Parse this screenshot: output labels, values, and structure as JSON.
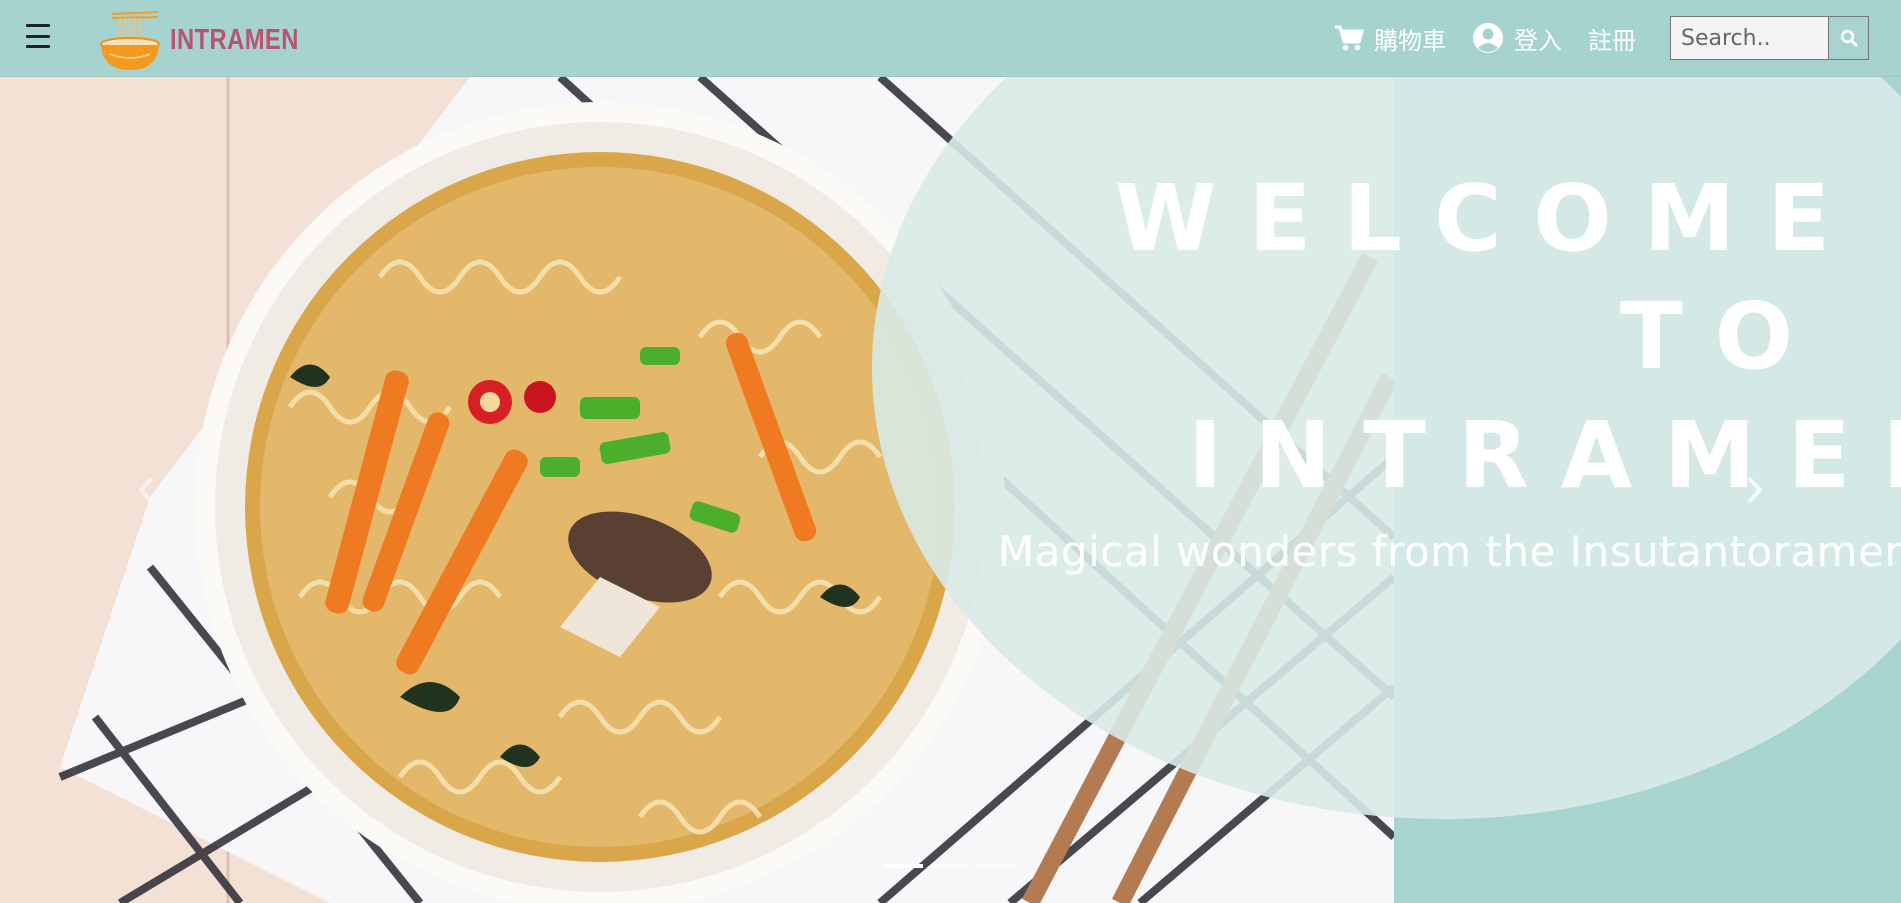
{
  "navbar": {
    "brand_name": "INTRAMEN",
    "cart_label": "購物車",
    "login_label": "登入",
    "register_label": "註冊",
    "search_placeholder": "Search.."
  },
  "hero": {
    "welcome_line1": "WELCOME",
    "welcome_line2": "TO",
    "welcome_line3": "INTRAMEN",
    "tagline": "Magical wonders from the Insutantoramen"
  },
  "carousel": {
    "slide_count": 3,
    "active_index": 0
  },
  "colors": {
    "nav_bg": "#a6d3cf",
    "brand": "#b8546f",
    "overlay": "#d8eae7",
    "accent_teal": "#a8d4cf"
  }
}
